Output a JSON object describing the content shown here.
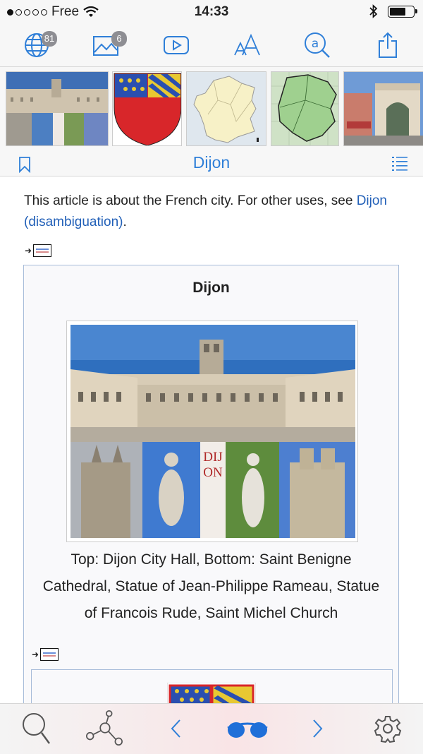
{
  "status_bar": {
    "carrier": "Free",
    "time": "14:33"
  },
  "toolbar": {
    "languages_icon": "globe-icon",
    "languages_count": "81",
    "images_icon": "image-icon",
    "images_count": "6",
    "video_icon": "play-icon",
    "text_size_icon": "text-size-icon",
    "at_search_icon": "at-search-icon",
    "share_icon": "share-icon"
  },
  "thumbnails": [
    {
      "name": "thumb-city-collage"
    },
    {
      "name": "thumb-coat-of-arms"
    },
    {
      "name": "thumb-france-map"
    },
    {
      "name": "thumb-region-map"
    },
    {
      "name": "thumb-porte-guillaume"
    }
  ],
  "title_bar": {
    "title": "Dijon",
    "bookmark_icon": "bookmark-icon",
    "contents_icon": "list-icon"
  },
  "article": {
    "hatnote_text": "This article is about the French city. For other uses, see ",
    "hatnote_link": "Dijon (disambiguation)",
    "hatnote_end": ".",
    "infobox": {
      "title": "Dijon",
      "collage_word": "DIJON",
      "caption": "Top: Dijon City Hall, Bottom: Saint Benigne Cathedral, Statue of Jean-Philippe Rameau, Statue of Francois Rude, Saint Michel Church"
    }
  },
  "bottom_bar": {
    "search_icon": "search-icon",
    "graph_icon": "network-icon",
    "back_icon": "chevron-left-icon",
    "reader_icon": "glasses-icon",
    "forward_icon": "chevron-right-icon",
    "settings_icon": "gear-icon"
  },
  "colors": {
    "accent": "#2f7fd8",
    "link": "#2260b8",
    "infobox_border": "#a7bcd9"
  }
}
